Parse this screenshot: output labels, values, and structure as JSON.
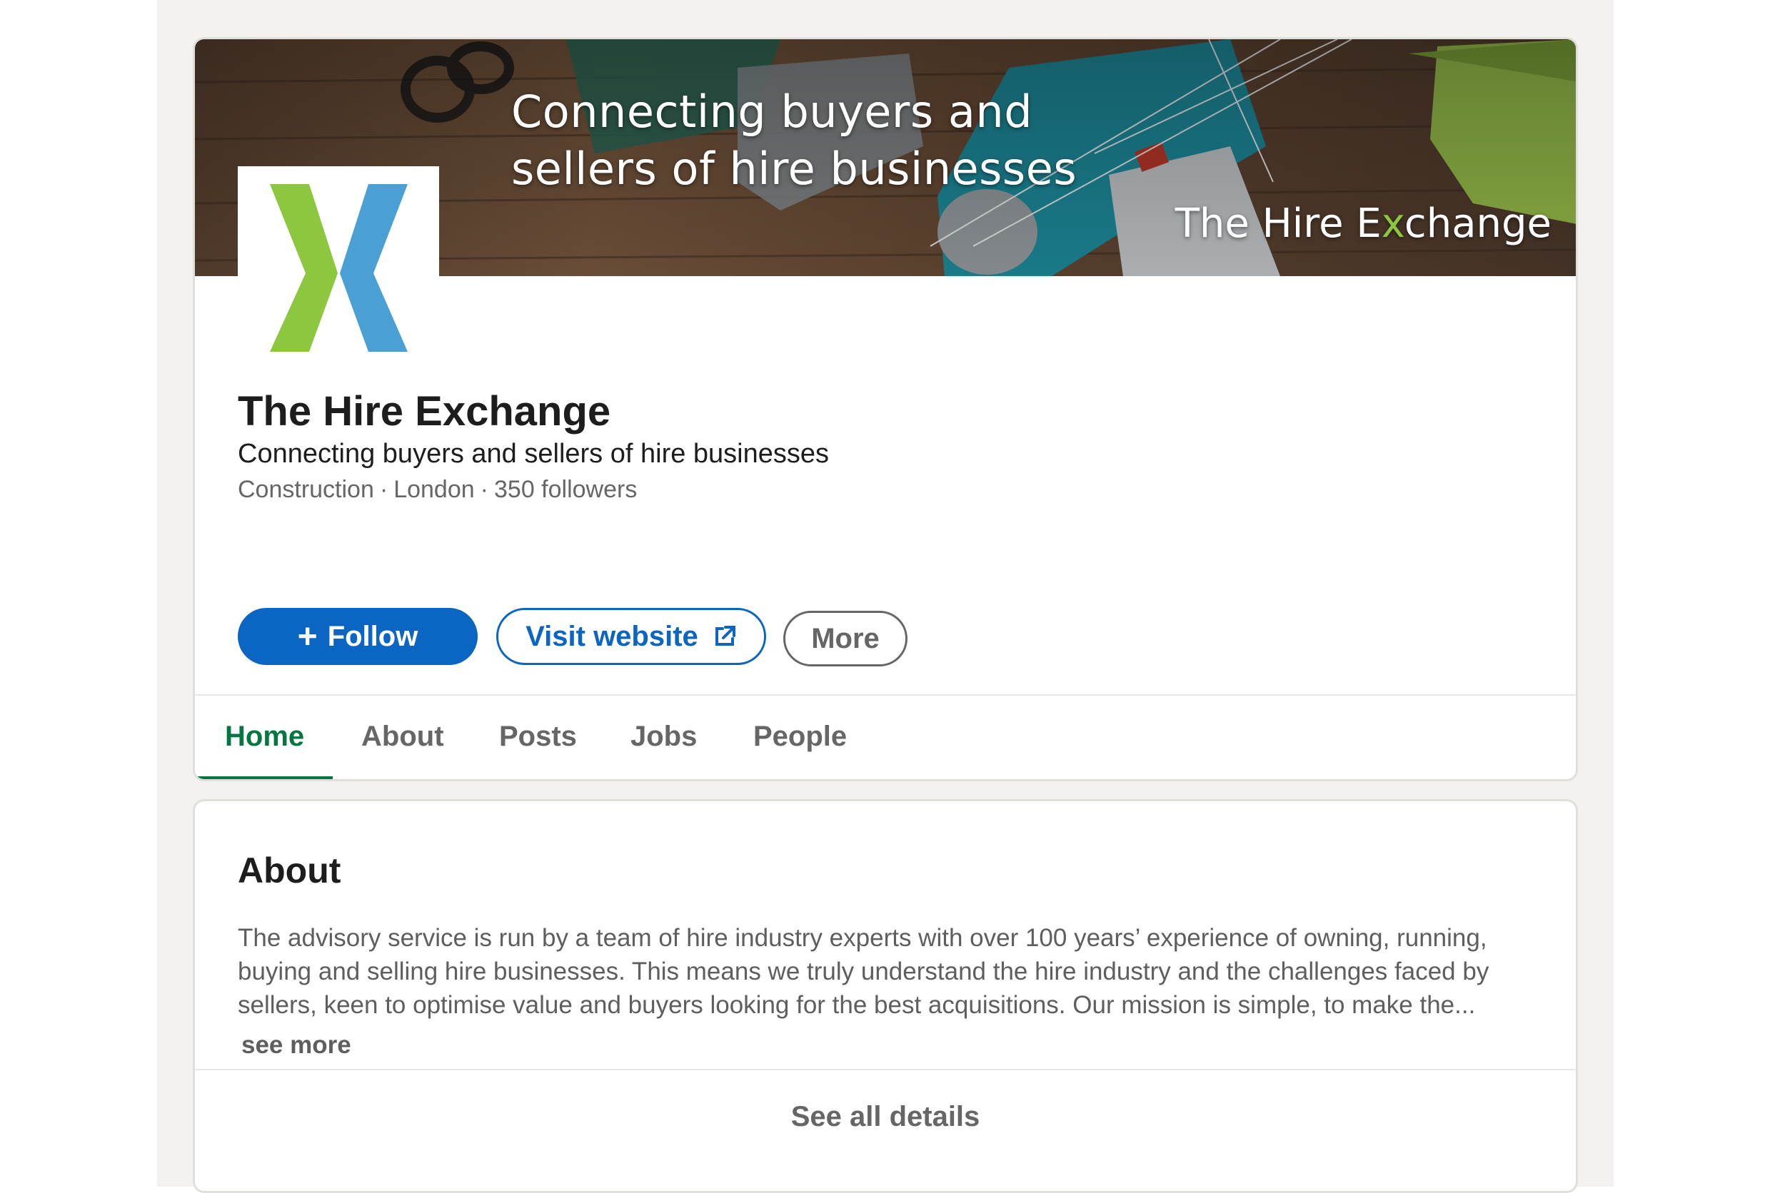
{
  "banner": {
    "tagline_line1": "Connecting buyers and",
    "tagline_line2": "sellers of hire businesses",
    "brand_pre": "The Hire E",
    "brand_x": "x",
    "brand_post": "change"
  },
  "logo": {
    "icon": "hire-exchange-x-logo",
    "green": "#8dc63f",
    "blue": "#4a9fd5"
  },
  "company": {
    "name": "The Hire Exchange",
    "tagline": "Connecting buyers and sellers of hire businesses",
    "industry": "Construction",
    "location": "London",
    "followers": "350 followers",
    "separator": "·"
  },
  "actions": {
    "follow_icon": "+",
    "follow_label": "Follow",
    "visit_label": "Visit website",
    "visit_icon": "external-link-icon",
    "more_label": "More"
  },
  "tabs": [
    {
      "label": "Home",
      "active": true
    },
    {
      "label": "About"
    },
    {
      "label": "Posts"
    },
    {
      "label": "Jobs"
    },
    {
      "label": "People"
    }
  ],
  "about": {
    "title": "About",
    "body": "The advisory service is run by a team of hire industry experts with over 100 years’ experience of owning, running, buying and selling hire businesses. This means we truly understand the hire industry and the challenges faced by sellers, keen to optimise value and buyers looking for the best acquisitions. Our mission is simple, to make the...",
    "see_more": "see more",
    "see_all": "See all details"
  },
  "colors": {
    "primary": "#0a66c2",
    "active_tab": "#057642",
    "page_bg": "#f3f2ef"
  }
}
